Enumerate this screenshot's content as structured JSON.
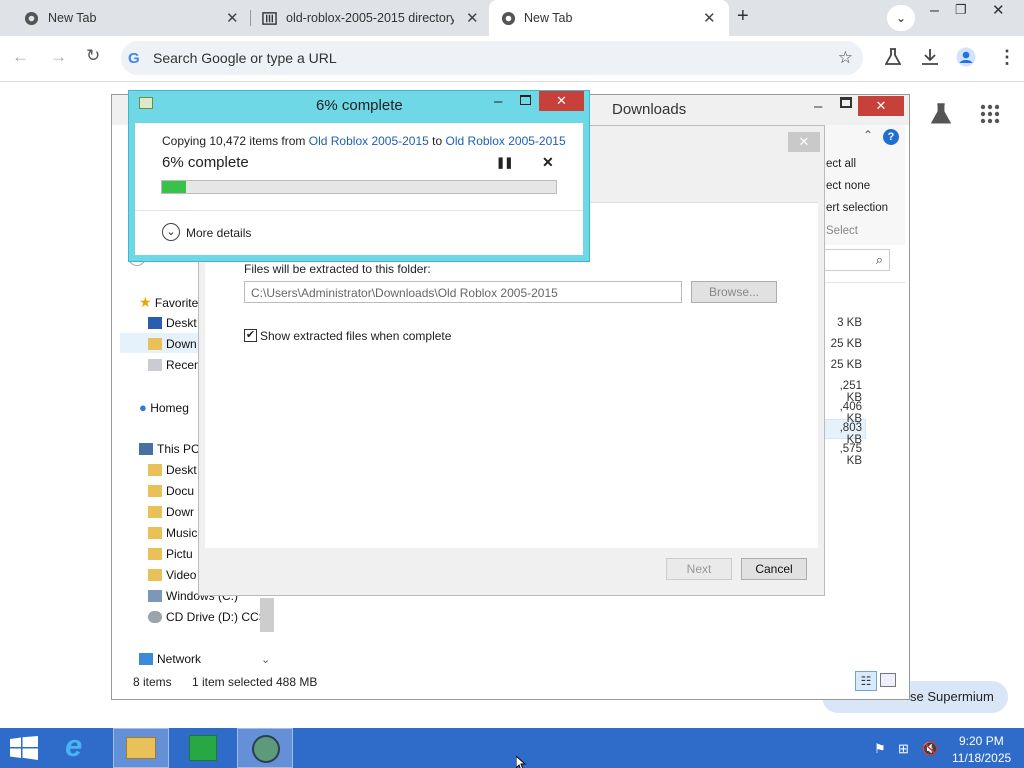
{
  "browser": {
    "tabs": [
      {
        "label": "New Tab",
        "icon": "chrome-icon"
      },
      {
        "label": "old-roblox-2005-2015 directory",
        "icon": "archive-icon"
      },
      {
        "label": "New Tab",
        "icon": "chrome-icon",
        "active": true
      }
    ],
    "omnibox_placeholder": "Search Google or type a URL",
    "new_tab_symbol": "+",
    "promo_label": "se Supermium"
  },
  "explorer": {
    "title": "Downloads",
    "ribbon": {
      "select_all": "ect all",
      "select_none": "ect none",
      "invert_selection": "ert selection",
      "group_label": "Select"
    },
    "nav": {
      "favorites": "Favorite",
      "desktop": "Deskt",
      "downloads": "Down",
      "recent": "Recen",
      "homegroup": "Homeg",
      "this_pc": "This PC",
      "pc_desktop": "Deskt",
      "documents": "Docu",
      "pc_downloads": "Dowr",
      "music": "Music",
      "pictures": "Pictu",
      "videos": "Video",
      "windows_c": "Windows (C:)",
      "cd_drive": "CD Drive (D:) CCS",
      "network": "Network"
    },
    "sizes": [
      "3 KB",
      "25 KB",
      "25 KB",
      ",251 KB",
      ",406 KB",
      ",803 KB",
      ",575 KB"
    ],
    "status": {
      "items": "8 items",
      "selected": "1 item selected",
      "size": "488 MB"
    }
  },
  "extract": {
    "dest_label": "Files will be extracted to this folder:",
    "dest_path": "C:\\Users\\Administrator\\Downloads\\Old Roblox 2005-2015",
    "browse": "Browse...",
    "show_files": "Show extracted files when complete",
    "show_files_checked": true,
    "next": "Next",
    "cancel": "Cancel"
  },
  "copy": {
    "title": "6% complete",
    "copying_prefix": "Copying 10,472 items from ",
    "source": "Old Roblox 2005-2015",
    "to_word": " to ",
    "dest": "Old Roblox 2005-2015",
    "percent_label": "6% complete",
    "progress": 0.06,
    "more_details": "More details"
  },
  "taskbar": {
    "time": "9:20 PM",
    "date": "11/18/2025"
  },
  "colors": {
    "copy_frame": "#6fd8e6",
    "close_red": "#c7403a",
    "progress_green": "#37c24a",
    "link_blue": "#1e5fb3",
    "taskbar_blue": "#2f6bc9"
  }
}
